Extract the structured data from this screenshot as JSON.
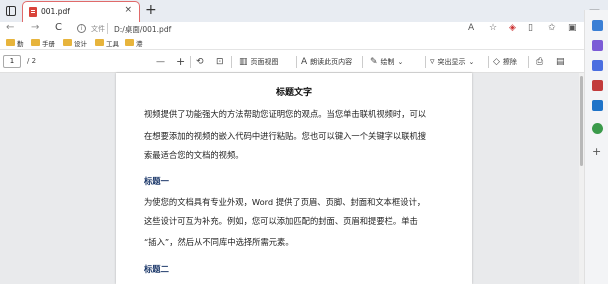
{
  "tab": {
    "title": "001.pdf",
    "close": "×",
    "new_tab": "+"
  },
  "window": {
    "minimize": "—"
  },
  "nav": {
    "back": "←",
    "forward": "→",
    "refresh": "C",
    "info_label": "文件",
    "url": "D:/桌面/001.pdf"
  },
  "bookmarks": [
    {
      "label": "勤"
    },
    {
      "label": "手册"
    },
    {
      "label": "设计"
    },
    {
      "label": "工具"
    },
    {
      "label": "港"
    }
  ],
  "pdf_toolbar": {
    "page_current": "1",
    "page_total": "/ 2",
    "zoom_out": "—",
    "zoom_in": "+",
    "page_view": "页面视图",
    "read_aloud": "朗读此页内容",
    "draw": "绘制",
    "highlight": "突出显示",
    "erase": "擦除"
  },
  "document": {
    "title": "标题文字",
    "para1": [
      "视频提供了功能强大的方法帮助您证明您的观点。当您单击联机视频时，可以",
      "在想要添加的视频的嵌入代码中进行粘贴。您也可以键入一个关键字以联机搜",
      "索最适合您的文档的视频。"
    ],
    "heading1": "标题一",
    "para2": [
      "为使您的文档具有专业外观，Word 提供了页眉、页脚、封面和文本框设计，",
      "这些设计可互为补充。例如，您可以添加匹配的封面、页眉和提要栏。单击",
      "“插入”，然后从不同库中选择所需元素。"
    ],
    "heading2": "标题二"
  },
  "colors": {
    "accent_red": "#d9433a",
    "heading_blue": "#1e3a6b",
    "folder_yellow": "#e7b43c"
  }
}
